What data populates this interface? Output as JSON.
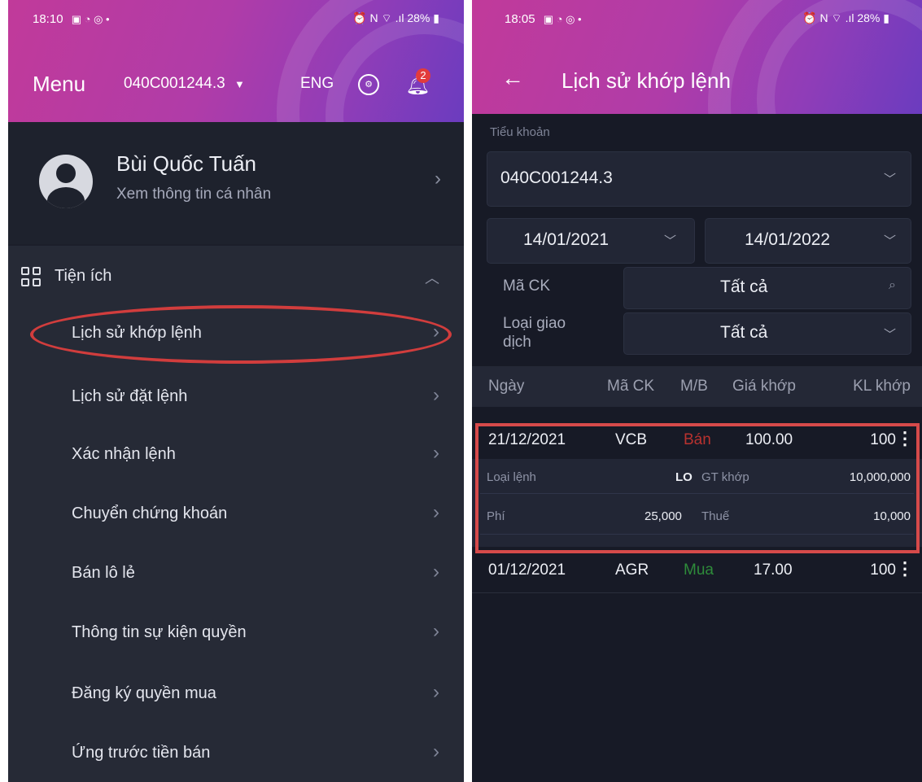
{
  "left": {
    "status_time": "18:10",
    "status_icons_left": "▣ ◔ ◎ •",
    "status_icons_right": "⏰ N ⌔ .ıl",
    "battery": "28%",
    "menu_title": "Menu",
    "account": "040C001244.3",
    "language": "ENG",
    "notification_count": "2",
    "profile_name": "Bùi Quốc Tuấn",
    "profile_sub": "Xem thông tin cá nhân",
    "section_label": "Tiện ích",
    "items": [
      {
        "label": "Lịch sử khớp lệnh"
      },
      {
        "label": "Lịch sử đặt lệnh"
      },
      {
        "label": "Xác nhận lệnh"
      },
      {
        "label": "Chuyển chứng khoán"
      },
      {
        "label": "Bán lô lẻ"
      },
      {
        "label": "Thông tin sự kiện quyền"
      },
      {
        "label": "Đăng ký quyền mua"
      },
      {
        "label": "Ứng trước tiền bán"
      }
    ]
  },
  "right": {
    "status_time": "18:05",
    "status_icons_left": "▣ ◔ ◎ •",
    "status_icons_right": "⏰ N ⌔ .ıl",
    "battery": "28%",
    "title": "Lịch sử khớp lệnh",
    "subaccount_label": "Tiểu khoản",
    "subaccount_value": "040C001244.3",
    "date_from": "14/01/2021",
    "date_to": "14/01/2022",
    "symbol_label": "Mã CK",
    "symbol_value": "Tất cả",
    "trade_type_label_1": "Loại giao",
    "trade_type_label_2": "dịch",
    "trade_type_value": "Tất cả",
    "columns": [
      "Ngày",
      "Mã CK",
      "M/B",
      "Giá khớp",
      "KL khớp"
    ],
    "rows": [
      {
        "date": "21/12/2021",
        "symbol": "VCB",
        "side": "Bán",
        "price": "100.00",
        "qty": "100"
      },
      {
        "date": "01/12/2021",
        "symbol": "AGR",
        "side": "Mua",
        "price": "17.00",
        "qty": "100"
      }
    ],
    "detail": {
      "order_type_label": "Loại lệnh",
      "order_type_value": "LO",
      "gt_label": "GT khớp",
      "gt_value": "10,000,000",
      "fee_label": "Phí",
      "fee_value": "25,000",
      "tax_label": "Thuế",
      "tax_value": "10,000"
    },
    "colors": {
      "sell": "#b8322f",
      "buy": "#2e8b3a",
      "highlight": "#d64a4a"
    }
  }
}
